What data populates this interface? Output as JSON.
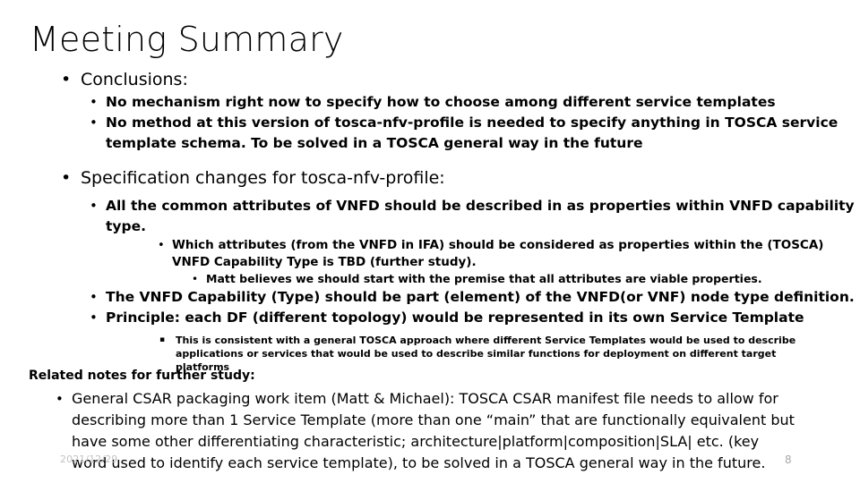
{
  "slide": {
    "title": "Meeting Summary",
    "sections": [
      {
        "level": 1,
        "bullet": "•",
        "text": "Conclusions:"
      },
      {
        "level": 2,
        "bullet": "•",
        "text": "No mechanism right now to specify how to choose among different service templates"
      },
      {
        "level": 2,
        "bullet": "•",
        "text": "No method at this version of tosca-nfv-profile is needed to specify anything in TOSCA service template schema.  To be solved in a TOSCA general way in the future"
      },
      {
        "level": 1,
        "bullet": "•",
        "text": "Specification changes for tosca-nfv-profile:"
      },
      {
        "level": 2,
        "bullet": "•",
        "text": "All the common attributes of VNFD should be described in as properties within VNFD capability type."
      },
      {
        "level": 3,
        "bullet": "•",
        "text": "Which attributes (from the VNFD in IFA) should be considered as properties within the (TOSCA) VNFD Capability Type is TBD (further study)."
      },
      {
        "level": 4,
        "bullet": "•",
        "text": "Matt believes we should start with the premise that all attributes are viable properties."
      },
      {
        "level": 2,
        "bullet": "•",
        "text": "The VNFD Capability (Type) should be part (element) of the VNFD(or VNF) node type definition."
      },
      {
        "level": 2,
        "bullet": "•",
        "text": "Principle: each DF (different topology) would be represented in its own Service Template"
      },
      {
        "level": 5,
        "bullet": "▪",
        "text": "This is consistent with a general TOSCA approach where different Service Templates would be used to describe applications or services that would be used to describe similar functions for deployment on different target platforms"
      }
    ]
  },
  "related": {
    "heading": "Related notes for further study:",
    "items": [
      {
        "bullet": "•",
        "text": "General CSAR packaging work item (Matt & Michael): TOSCA CSAR manifest file needs to allow for describing more than 1 Service Template (more than one “main” that are functionally equivalent but have some other differentiating characteristic; architecture|platform|composition|SLA| etc. (key word used to identify each service template), to be solved in a TOSCA general way in the future."
      }
    ]
  },
  "footer": {
    "date": "2021/12/29",
    "page_number": "8"
  },
  "colors": {
    "text": "#000000",
    "footer_date": "#c3c3c3",
    "footer_page": "#a9a9a9",
    "background": "#ffffff"
  }
}
